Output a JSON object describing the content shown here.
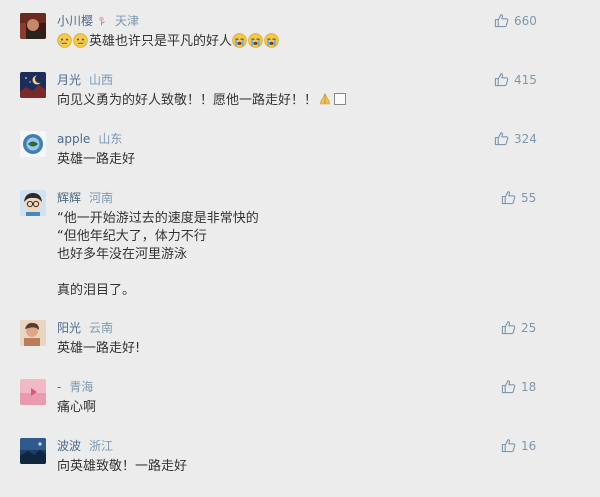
{
  "comments": [
    {
      "nickname": "小川樱",
      "location": "天津",
      "text_before": "",
      "text_main": "英雄也许只是平凡的好人",
      "likes": "660",
      "avatar_icon": "dark-red-portrait-avatar",
      "badge_icon": "flower-badge-icon",
      "emoji_icon": "crying-face-emoji"
    },
    {
      "nickname": "月光",
      "location": "山西",
      "text_main": "向见义勇为的好人致敬！！愿他一路走好！！",
      "likes": "415",
      "avatar_icon": "night-sky-avatar",
      "trailing_icons": [
        "praying-hands-emoji",
        "missing-glyph-box"
      ]
    },
    {
      "nickname": "apple",
      "location": "山东",
      "text_main": "英雄一路走好",
      "likes": "324",
      "avatar_icon": "blue-globe-avatar"
    },
    {
      "nickname": "辉辉",
      "location": "河南",
      "lines": [
        "“他一开始游过去的速度是非常快的",
        "“但他年纪大了，体力不行",
        "也好多年没在河里游泳",
        "",
        "真的泪目了。"
      ],
      "likes": "55",
      "avatar_icon": "cartoon-boy-glasses-avatar"
    },
    {
      "nickname": "阳光",
      "location": "云南",
      "text_main": "英雄一路走好!",
      "likes": "25",
      "avatar_icon": "warm-portrait-avatar"
    },
    {
      "nickname": "-",
      "location": "青海",
      "text_main": "痛心啊",
      "likes": "18",
      "avatar_icon": "pink-play-avatar"
    },
    {
      "nickname": "波波",
      "location": "浙江",
      "text_main": "向英雄致敬！一路走好",
      "likes": "16",
      "avatar_icon": "dark-blue-landscape-avatar"
    }
  ],
  "colors": {
    "background": "#ececec",
    "nickname": "#4d6b8a",
    "location": "#7d98b4",
    "like": "#7f97ad",
    "text": "#333333"
  },
  "icons": {
    "like": "thumbs-up-icon"
  }
}
